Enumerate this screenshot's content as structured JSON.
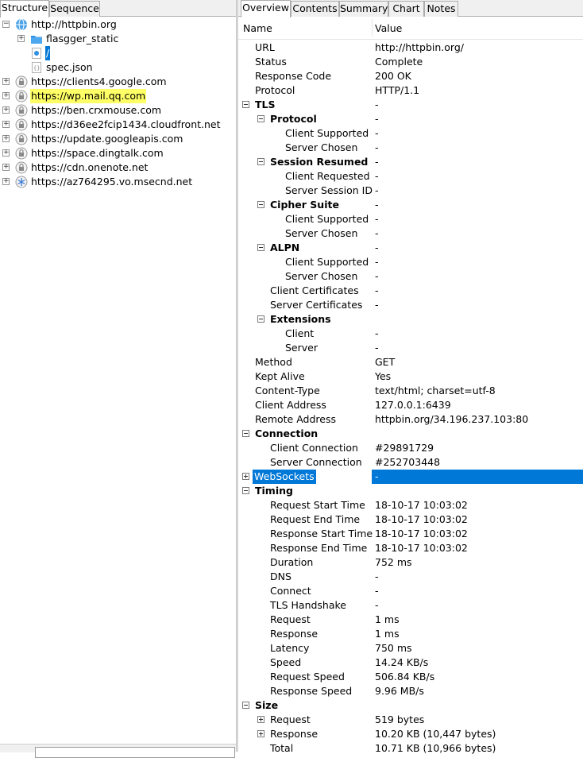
{
  "left_tabs": [
    {
      "label": "Structure",
      "active": true
    },
    {
      "label": "Sequence",
      "active": false
    }
  ],
  "tree": [
    {
      "label": "http://httpbin.org",
      "expanded": true,
      "icon": "globe-icon"
    },
    {
      "label": "flasgger_static",
      "icon": "folder-icon"
    },
    {
      "label": "/",
      "icon": "page-icon",
      "selected": true
    },
    {
      "label": "spec.json",
      "icon": "json-file-icon"
    },
    {
      "label": "https://clients4.google.com",
      "icon": "lock-icon"
    },
    {
      "label": "https://wp.mail.qq.com",
      "icon": "lock-icon",
      "highlight": "yellow"
    },
    {
      "label": "https://ben.crxmouse.com",
      "icon": "lock-icon"
    },
    {
      "label": "https://d36ee2fcip1434.cloudfront.net",
      "icon": "lock-icon"
    },
    {
      "label": "https://update.googleapis.com",
      "icon": "lock-icon"
    },
    {
      "label": "https://space.dingtalk.com",
      "icon": "lock-icon"
    },
    {
      "label": "https://cdn.onenote.net",
      "icon": "lock-icon"
    },
    {
      "label": "https://az764295.vo.msecnd.net",
      "icon": "snowflake-icon"
    }
  ],
  "right_tabs": [
    {
      "label": "Overview",
      "active": true
    },
    {
      "label": "Contents",
      "active": false
    },
    {
      "label": "Summary",
      "active": false
    },
    {
      "label": "Chart",
      "active": false
    },
    {
      "label": "Notes",
      "active": false
    }
  ],
  "grid_header": {
    "name": "Name",
    "value": "Value"
  },
  "overview": [
    {
      "name": "URL",
      "value": "http://httpbin.org/"
    },
    {
      "name": "Status",
      "value": "Complete"
    },
    {
      "name": "Response Code",
      "value": "200 OK"
    },
    {
      "name": "Protocol",
      "value": "HTTP/1.1"
    },
    {
      "name": "TLS",
      "value": "-",
      "section": true
    },
    {
      "name": "Protocol",
      "value": "-",
      "group": true
    },
    {
      "name": "Client Supported",
      "value": "-"
    },
    {
      "name": "Server Chosen",
      "value": "-"
    },
    {
      "name": "Session Resumed",
      "value": "-",
      "group": true
    },
    {
      "name": "Client Requested",
      "value": "-"
    },
    {
      "name": "Server Session ID",
      "value": "-"
    },
    {
      "name": "Cipher Suite",
      "value": "-",
      "group": true
    },
    {
      "name": "Client Supported",
      "value": "-"
    },
    {
      "name": "Server Chosen",
      "value": "-"
    },
    {
      "name": "ALPN",
      "value": "-",
      "group": true
    },
    {
      "name": "Client Supported",
      "value": "-"
    },
    {
      "name": "Server Chosen",
      "value": "-"
    },
    {
      "name": "Client Certificates",
      "value": "-"
    },
    {
      "name": "Server Certificates",
      "value": "-"
    },
    {
      "name": "Extensions",
      "value": "",
      "group": true
    },
    {
      "name": "Client",
      "value": "-"
    },
    {
      "name": "Server",
      "value": "-"
    },
    {
      "name": "Method",
      "value": "GET"
    },
    {
      "name": "Kept Alive",
      "value": "Yes"
    },
    {
      "name": "Content-Type",
      "value": "text/html; charset=utf-8"
    },
    {
      "name": "Client Address",
      "value": "127.0.0.1:6439"
    },
    {
      "name": "Remote Address",
      "value": "httpbin.org/34.196.237.103:80"
    },
    {
      "name": "Connection",
      "value": "",
      "section": true
    },
    {
      "name": "Client Connection",
      "value": "#29891729"
    },
    {
      "name": "Server Connection",
      "value": "#252703448"
    },
    {
      "name": "WebSockets",
      "value": "-",
      "selected": true
    },
    {
      "name": "Timing",
      "value": "",
      "section": true
    },
    {
      "name": "Request Start Time",
      "value": "18-10-17 10:03:02"
    },
    {
      "name": "Request End Time",
      "value": "18-10-17 10:03:02"
    },
    {
      "name": "Response Start Time",
      "value": "18-10-17 10:03:02"
    },
    {
      "name": "Response End Time",
      "value": "18-10-17 10:03:02"
    },
    {
      "name": "Duration",
      "value": "752 ms"
    },
    {
      "name": "DNS",
      "value": "-"
    },
    {
      "name": "Connect",
      "value": "-"
    },
    {
      "name": "TLS Handshake",
      "value": "-"
    },
    {
      "name": "Request",
      "value": "1 ms"
    },
    {
      "name": "Response",
      "value": "1 ms"
    },
    {
      "name": "Latency",
      "value": "750 ms"
    },
    {
      "name": "Speed",
      "value": "14.24 KB/s"
    },
    {
      "name": "Request Speed",
      "value": "506.84 KB/s"
    },
    {
      "name": "Response Speed",
      "value": "9.96 MB/s"
    },
    {
      "name": "Size",
      "value": "",
      "section": true
    },
    {
      "name": "Request",
      "value": "519 bytes"
    },
    {
      "name": "Response",
      "value": "10.20 KB (10,447 bytes)"
    },
    {
      "name": "Total",
      "value": "10.71 KB (10,966 bytes)"
    }
  ]
}
